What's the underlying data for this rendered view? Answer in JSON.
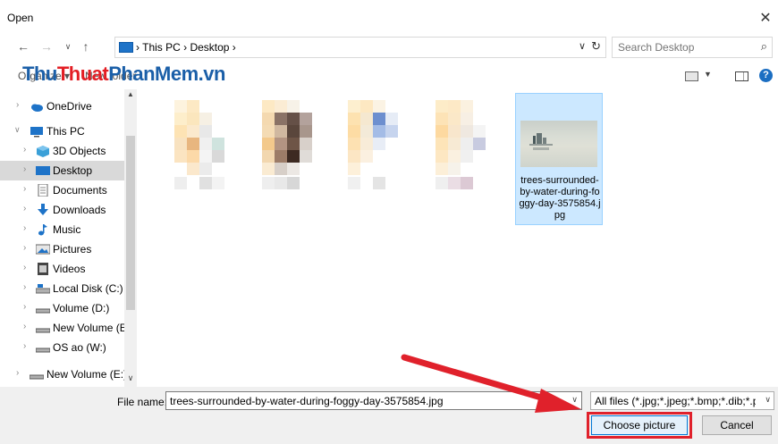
{
  "window": {
    "title": "Open"
  },
  "address": {
    "path": "›  This PC  ›  Desktop  ›"
  },
  "search": {
    "placeholder": "Search Desktop"
  },
  "toolbar": {
    "organize": "Organize ▾",
    "new_folder": "New folder"
  },
  "watermark": {
    "part1": "Thu",
    "part2": "Thuat",
    "part3": "Phan",
    "part4": "Mem",
    "part5": ".vn"
  },
  "navpane": {
    "items": [
      {
        "label": "OneDrive",
        "icon": "onedrive-icon"
      },
      {
        "label": "This PC",
        "icon": "computer-icon"
      },
      {
        "label": "3D Objects",
        "icon": "3d-objects-icon"
      },
      {
        "label": "Desktop",
        "icon": "desktop-icon"
      },
      {
        "label": "Documents",
        "icon": "documents-icon"
      },
      {
        "label": "Downloads",
        "icon": "downloads-icon"
      },
      {
        "label": "Music",
        "icon": "music-icon"
      },
      {
        "label": "Pictures",
        "icon": "pictures-icon"
      },
      {
        "label": "Videos",
        "icon": "videos-icon"
      },
      {
        "label": "Local Disk (C:)",
        "icon": "local-disk-icon"
      },
      {
        "label": "Volume (D:)",
        "icon": "drive-icon"
      },
      {
        "label": "New Volume (E:)",
        "icon": "drive-icon"
      },
      {
        "label": "OS ao (W:)",
        "icon": "drive-icon"
      },
      {
        "label": "New Volume (E:)",
        "icon": "drive-icon"
      }
    ]
  },
  "files": {
    "selected_name": "trees-surrounded-by-water-during-foggy-day-3575854.jpg"
  },
  "bottom": {
    "filename_label": "File name:",
    "filename_value": "trees-surrounded-by-water-during-foggy-day-3575854.jpg",
    "filetype": "All files (*.jpg;*.jpeg;*.bmp;*.dib;*.png",
    "choose_label": "Choose picture",
    "cancel_label": "Cancel"
  },
  "colors": {
    "accent": "#0078d7",
    "highlight": "#e0212b",
    "selection": "#cce8ff"
  }
}
